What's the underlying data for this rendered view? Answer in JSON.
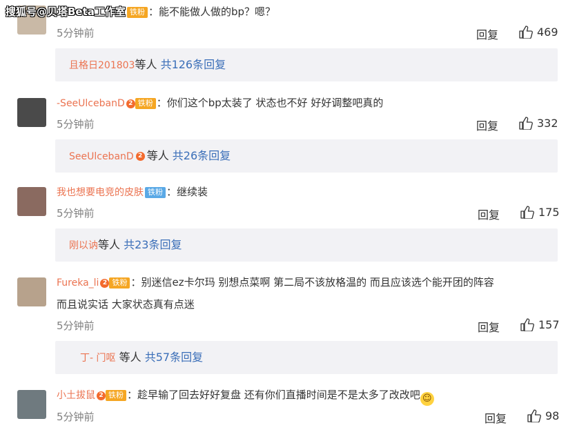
{
  "watermark": "搜狐号@贝塔Beta工作室",
  "colors": {
    "name": "#eb7350",
    "link": "#3a6eb8",
    "meta": "#808080",
    "subbg": "#f2f2f5"
  },
  "comments": [
    {
      "avatar_color": "#c9b9a6",
      "text": "能不能做人做的bp？嗯？",
      "time": "5分钟前",
      "reply": "回复",
      "likes": "469",
      "sub": {
        "name": "且格日201803",
        "suffix": "等人",
        "count": "共126条回复"
      }
    },
    {
      "avatar_color": "#4a4a4a",
      "name": "-SeeUlcebanD",
      "badge": "铁粉",
      "text": "你们这个bp太装了 状态也不好 好好调整吧真的",
      "time": "5分钟前",
      "reply": "回复",
      "likes": "332",
      "sub": {
        "name": "SeeUlcebanD",
        "suffix": "等人",
        "count": "共26条回复"
      }
    },
    {
      "avatar_color": "#8a6a60",
      "name": "我也想要电竞的皮肤",
      "badge": "铁粉",
      "text": "继续装",
      "time": "5分钟前",
      "reply": "回复",
      "likes": "175",
      "sub": {
        "name": "刚以讷",
        "suffix": "等人",
        "count": "共23条回复"
      }
    },
    {
      "avatar_color": "#b7a28c",
      "name": "Fureka_li",
      "badge": "铁粉",
      "text": "别迷信ez卡尔玛 别想点菜啊 第二局不该放格温的 而且应该选个能开团的阵容",
      "text2": "而且说实话 大家状态真有点迷",
      "time": "5分钟前",
      "reply": "回复",
      "likes": "157",
      "sub": {
        "name": "丁- 门呕",
        "suffix": "等人",
        "count": "共57条回复"
      }
    },
    {
      "avatar_color": "#6f7a7f",
      "name": "小土拔鼠",
      "badge": "铁粉",
      "text": "趁早输了回去好好复盘 还有你们直播时间是不是太多了改改吧",
      "time": "5分钟前",
      "reply": "回复",
      "likes": "98"
    }
  ]
}
